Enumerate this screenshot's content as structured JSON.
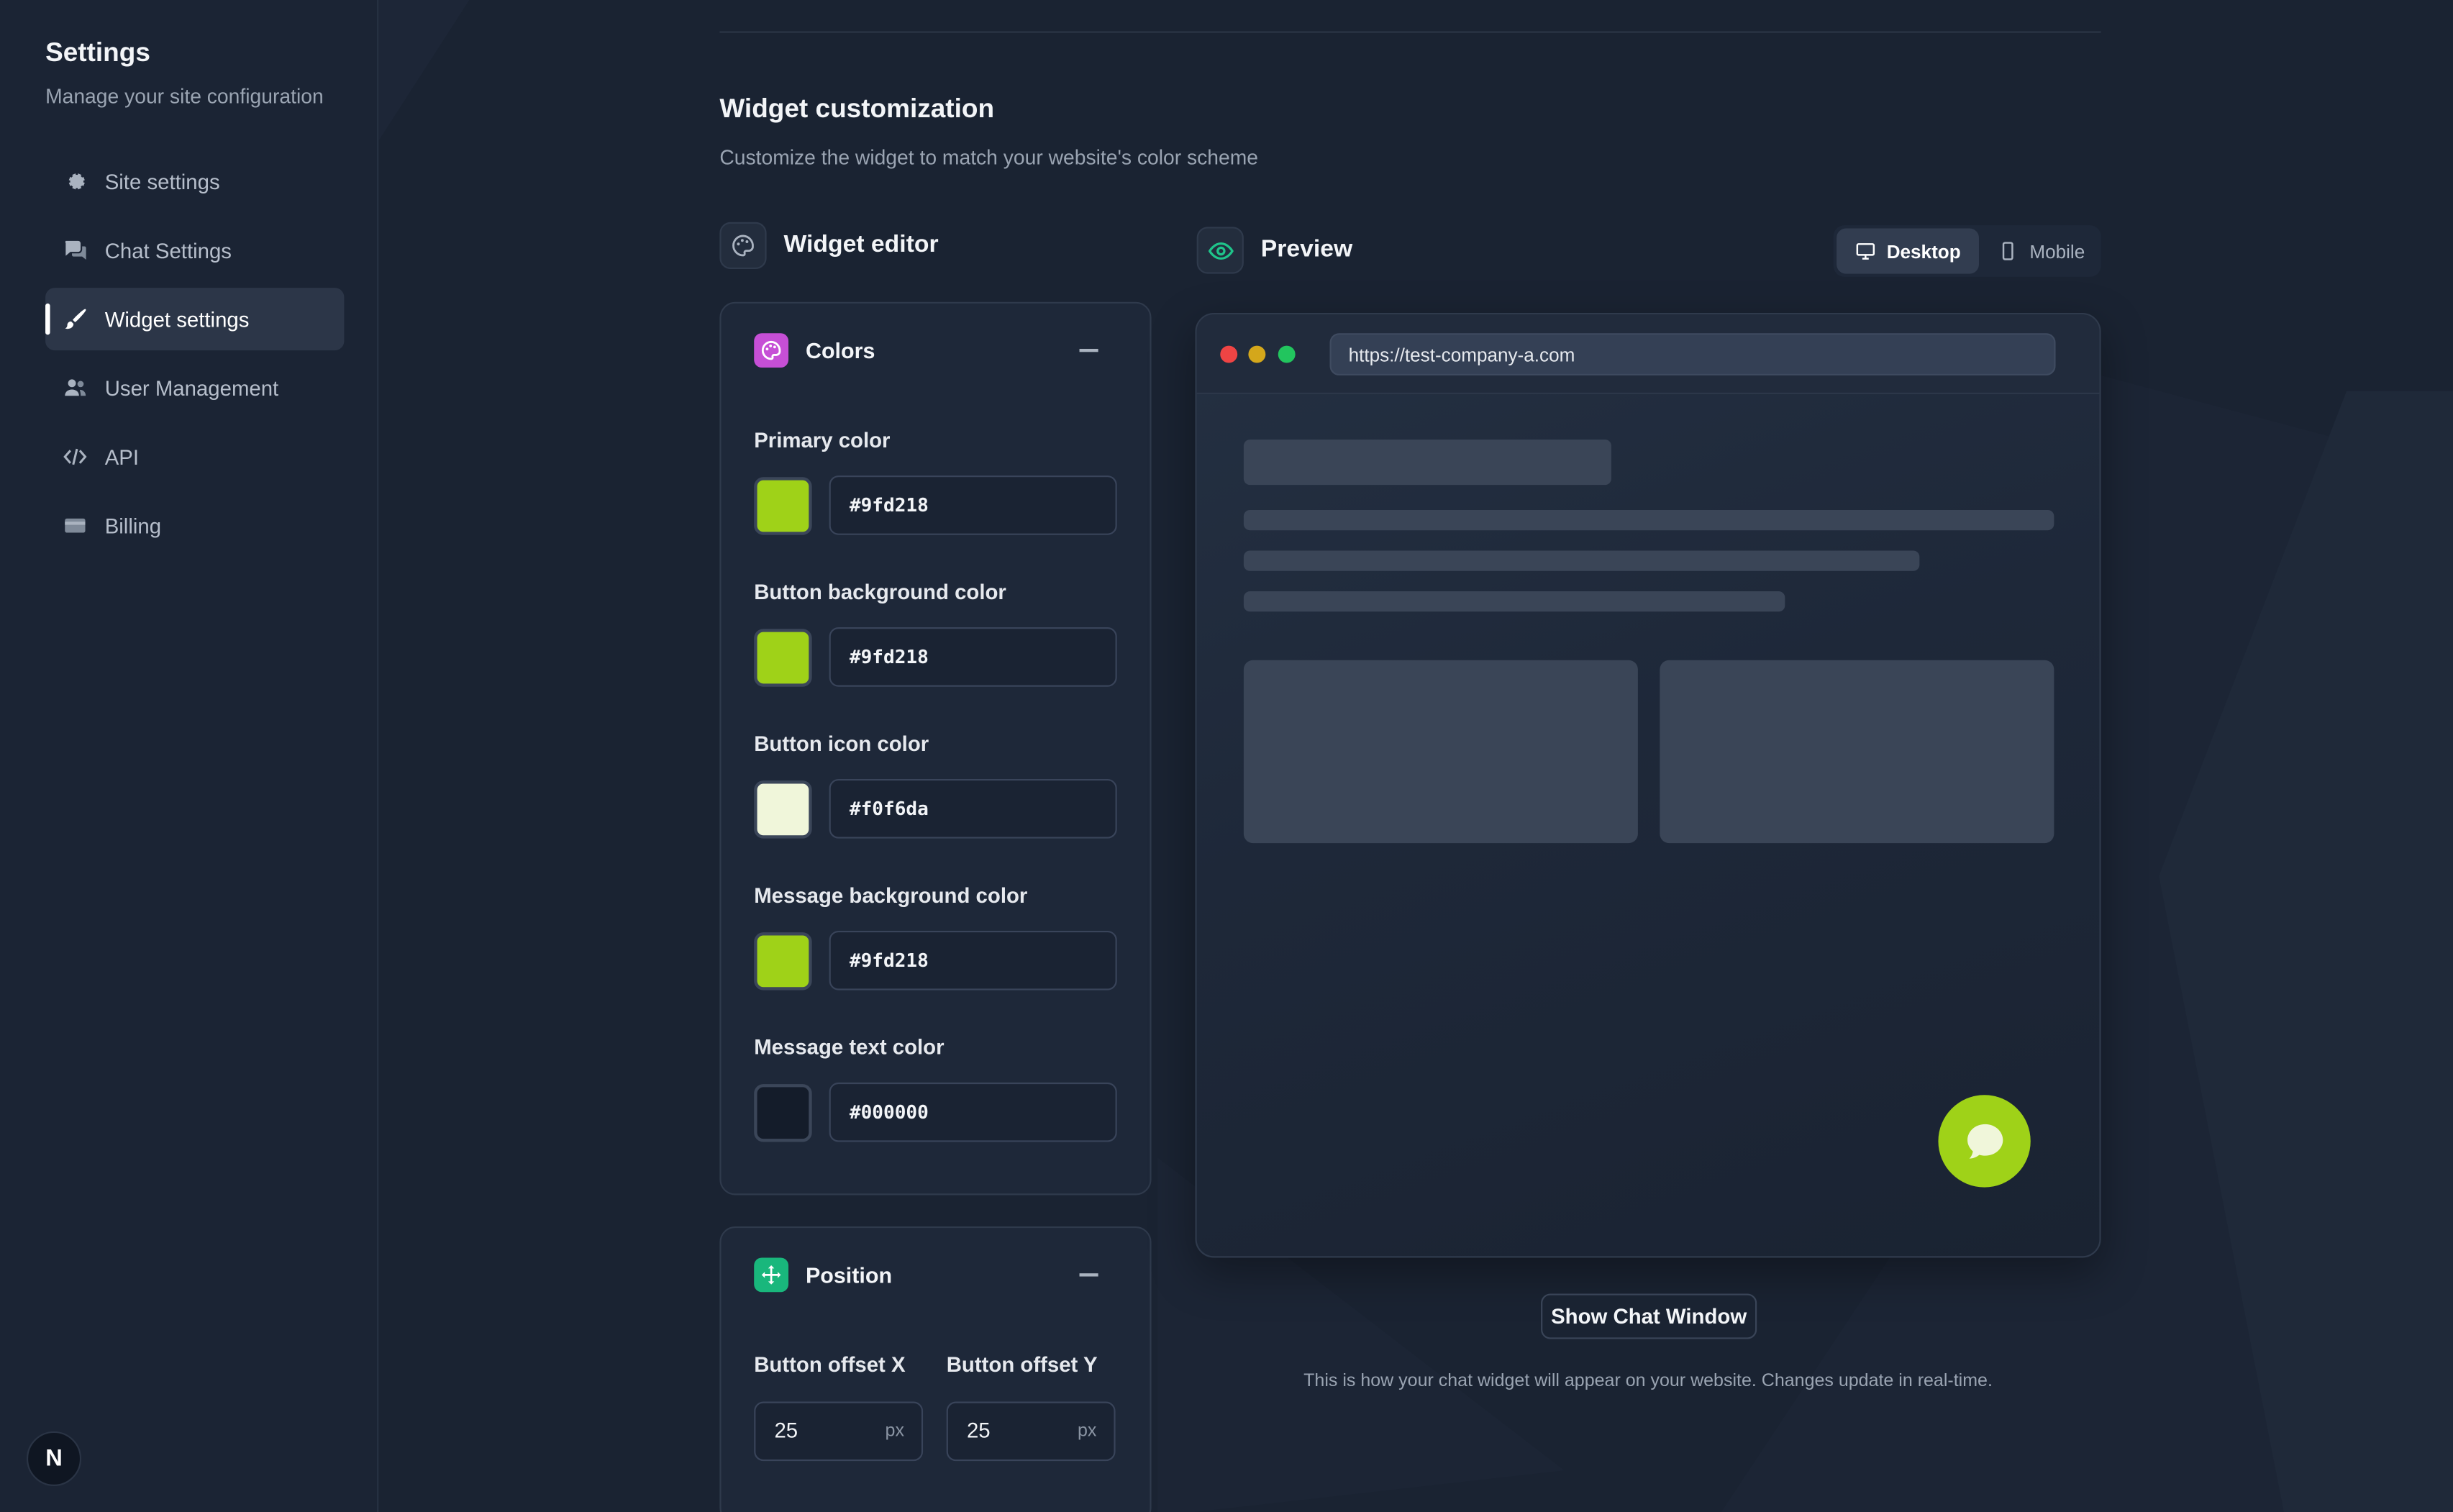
{
  "sidebar": {
    "title": "Settings",
    "subtitle": "Manage your site configuration",
    "items": [
      {
        "label": "Site settings",
        "icon": "gear-icon"
      },
      {
        "label": "Chat Settings",
        "icon": "chat-bubbles-icon"
      },
      {
        "label": "Widget settings",
        "icon": "brush-icon",
        "active": true
      },
      {
        "label": "User Management",
        "icon": "users-icon"
      },
      {
        "label": "API",
        "icon": "code-icon"
      },
      {
        "label": "Billing",
        "icon": "credit-card-icon"
      }
    ],
    "logo_letter": "N"
  },
  "main": {
    "title": "Widget customization",
    "subtitle": "Customize the widget to match your website's color scheme"
  },
  "editor": {
    "title": "Widget editor",
    "colors_card": {
      "title": "Colors",
      "fields": [
        {
          "label": "Primary color",
          "value": "#9fd218"
        },
        {
          "label": "Button background color",
          "value": "#9fd218"
        },
        {
          "label": "Button icon color",
          "value": "#f0f6da"
        },
        {
          "label": "Message background color",
          "value": "#9fd218"
        },
        {
          "label": "Message text color",
          "value": "#000000"
        }
      ]
    },
    "position_card": {
      "title": "Position",
      "offset_x_label": "Button offset X",
      "offset_x_value": "25",
      "offset_y_label": "Button offset Y",
      "offset_y_value": "25",
      "unit": "px"
    }
  },
  "preview": {
    "title": "Preview",
    "toggle_desktop": "Desktop",
    "toggle_mobile": "Mobile",
    "url": "https://test-company-a.com",
    "show_chat_label": "Show Chat Window",
    "note": "This is how your chat widget will appear on your website. Changes update in real-time."
  },
  "colors": {
    "accent": "#9fd218",
    "background": "#1a2332",
    "card": "#1e2839"
  }
}
